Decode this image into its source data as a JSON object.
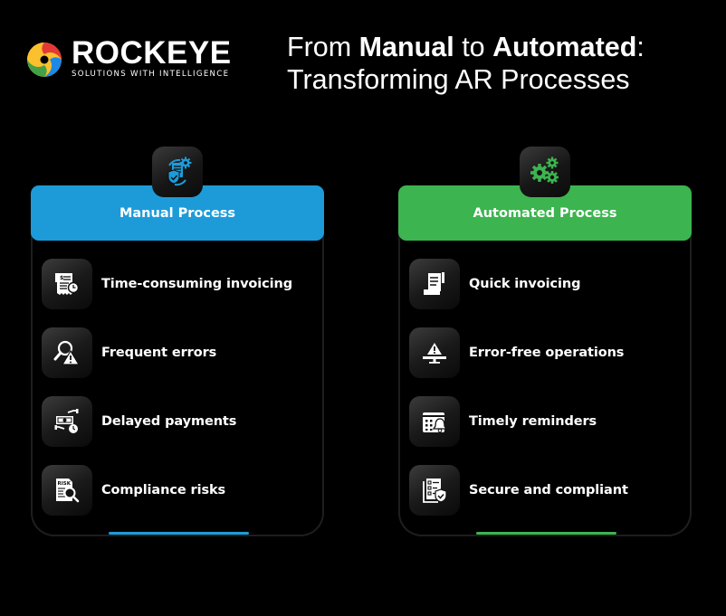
{
  "brand": {
    "name": "ROCKEYE",
    "tagline": "SOLUTIONS WITH INTELLIGENCE",
    "logo_icon": "swirl-logo-icon",
    "logo_colors": [
      "#e53935",
      "#fbc02d",
      "#1e88e5",
      "#43a047"
    ]
  },
  "heading": {
    "line1_part1": "From ",
    "line1_bold1": "Manual",
    "line1_part2": " to ",
    "line1_bold2": "Automated",
    "line1_part3": ":",
    "line2": "Transforming AR Processes"
  },
  "colors": {
    "background": "#000000",
    "manual_accent": "#1d9bd9",
    "automated_accent": "#3cb44f",
    "card_border": "#1e1e1e",
    "text": "#ffffff"
  },
  "cards": [
    {
      "id": "manual",
      "title": "Manual Process",
      "badge_icon": "document-shield-gear-icon",
      "items": [
        {
          "label": "Time-consuming invoicing",
          "icon": "receipt-clock-icon"
        },
        {
          "label": "Frequent errors",
          "icon": "magnifier-warning-icon"
        },
        {
          "label": "Delayed payments",
          "icon": "money-clock-icon"
        },
        {
          "label": "Compliance risks",
          "icon": "risk-document-search-icon"
        }
      ]
    },
    {
      "id": "automated",
      "title": "Automated Process",
      "badge_icon": "gears-icon",
      "items": [
        {
          "label": "Quick invoicing",
          "icon": "scroll-invoice-icon"
        },
        {
          "label": "Error-free operations",
          "icon": "monitor-warning-icon"
        },
        {
          "label": "Timely reminders",
          "icon": "calendar-bell-icon"
        },
        {
          "label": "Secure and compliant",
          "icon": "checklist-shield-icon"
        }
      ]
    }
  ]
}
